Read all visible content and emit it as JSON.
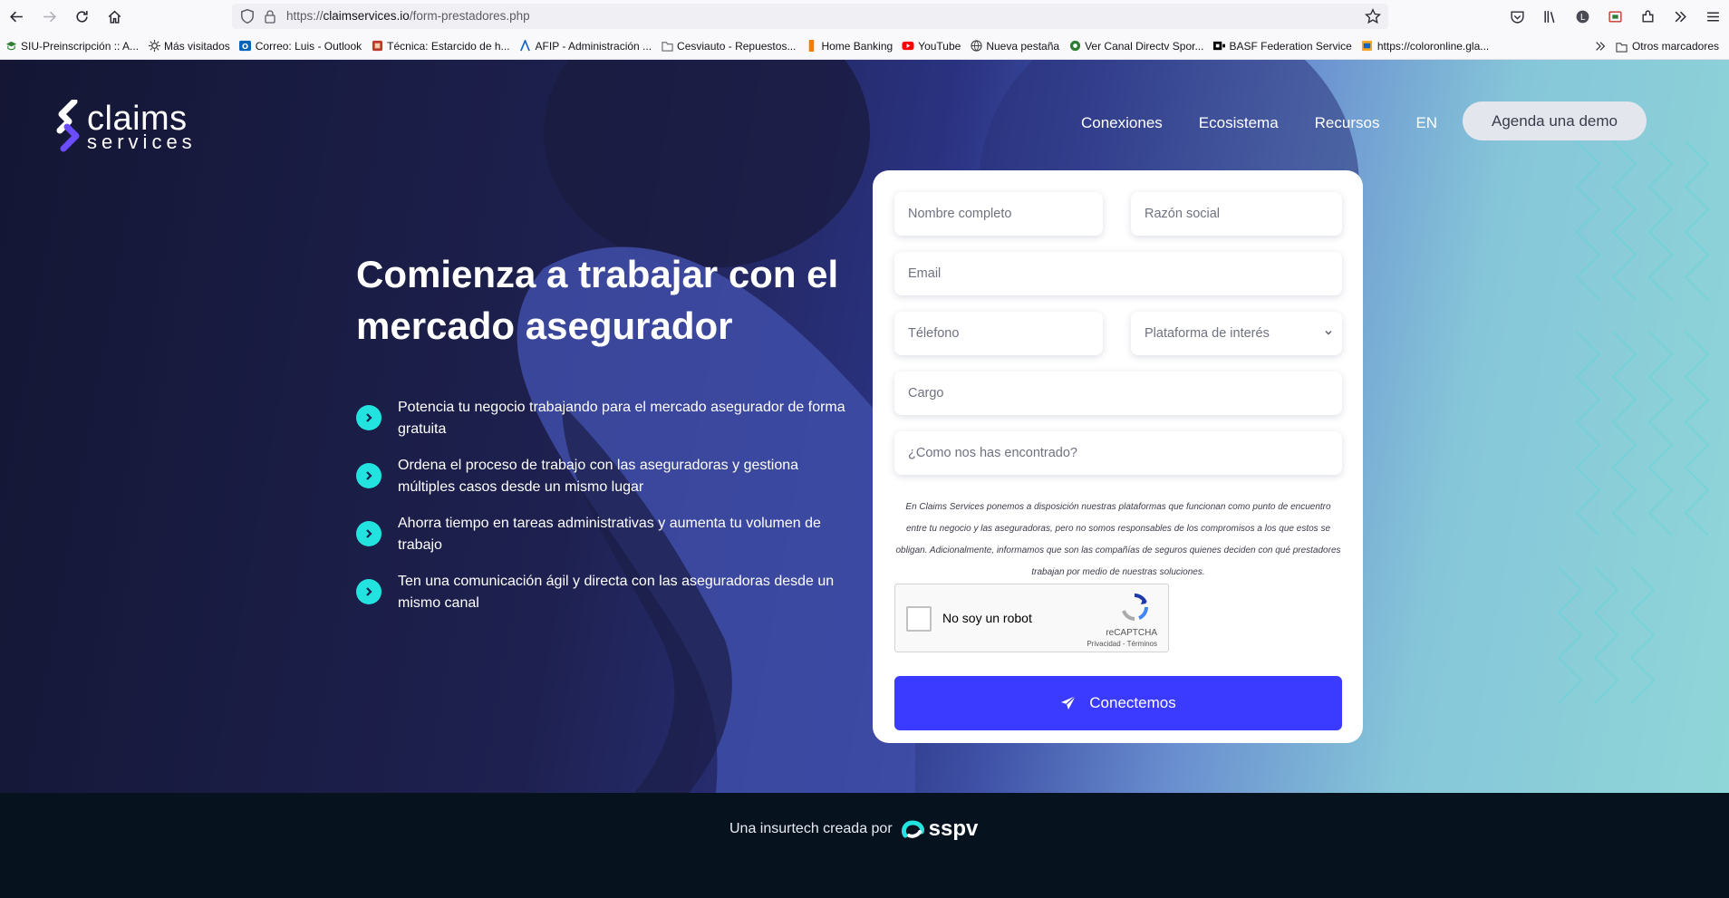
{
  "browser": {
    "url_prefix": "https://",
    "url_domain": "claimservices.io",
    "url_path": "/form-prestadores.php"
  },
  "bookmarks": {
    "items": [
      {
        "label": "SIU-Preinscripción :: A...",
        "icon": "graduation-icon",
        "color": "#2e7d32"
      },
      {
        "label": "Más visitados",
        "icon": "gear-icon",
        "color": "#4a4a4a"
      },
      {
        "label": "Correo: Luis - Outlook",
        "icon": "outlook-icon",
        "color": "#0364b8"
      },
      {
        "label": "Técnica: Estarcido de h...",
        "icon": "page-icon",
        "color": "#c0392b"
      },
      {
        "label": "AFIP - Administración ...",
        "icon": "afip-icon",
        "color": "#1565c0"
      },
      {
        "label": "Cesviauto - Repuestos...",
        "icon": "folder-icon",
        "color": "#666666"
      },
      {
        "label": "Home Banking",
        "icon": "bank-icon",
        "color": "#f57c00"
      },
      {
        "label": "YouTube",
        "icon": "youtube-icon",
        "color": "#ff0000"
      },
      {
        "label": "Nueva pestaña",
        "icon": "globe-icon",
        "color": "#444444"
      },
      {
        "label": "Ver Canal Directv Spor...",
        "icon": "soccer-icon",
        "color": "#2e7d32"
      },
      {
        "label": "BASF Federation Service",
        "icon": "basf-icon",
        "color": "#000000"
      },
      {
        "label": "https://coloronline.gla...",
        "icon": "page-icon",
        "color": "#f9a825"
      }
    ],
    "other": "Otros marcadores"
  },
  "site": {
    "logo_line1": "claims",
    "logo_line2": "services",
    "nav": [
      "Conexiones",
      "Ecosistema",
      "Recursos",
      "EN"
    ],
    "demo_button": "Agenda una demo",
    "headline": "Comienza a trabajar con el mercado asegurador",
    "benefits": [
      "Potencia tu negocio trabajando para el mercado asegurador de forma gratuita",
      "Ordena el proceso de trabajo con las aseguradoras y gestiona múltiples casos desde un mismo lugar",
      "Ahorra tiempo en tareas administrativas y aumenta tu volumen de trabajo",
      "Ten una comunicación ágil y directa con las aseguradoras desde un mismo canal"
    ],
    "colors": {
      "accent": "#22e3df",
      "button": "#3b3aff"
    }
  },
  "form": {
    "name_placeholder": "Nombre completo",
    "company_placeholder": "Razón social",
    "email_placeholder": "Email",
    "phone_placeholder": "Télefono",
    "platform_select": "Plataforma de interés",
    "role_placeholder": "Cargo",
    "source_placeholder": "¿Como nos has encontrado?",
    "disclaimer": "En Claims Services ponemos a disposición nuestras plataformas que funcionan como punto de encuentro entre tu negocio y las aseguradoras, pero no somos responsables de los compromisos a los que estos se obligan. Adicionalmente, informamos que son las compañías de seguros quienes deciden con qué prestadores trabajan por medio de nuestras soluciones.",
    "captcha_label": "No soy un robot",
    "captcha_brand": "reCAPTCHA",
    "captcha_links": "Privacidad - Términos",
    "submit": "Conectemos"
  },
  "footer": {
    "made_by": "Una insurtech creada por",
    "brand": "sspv"
  }
}
